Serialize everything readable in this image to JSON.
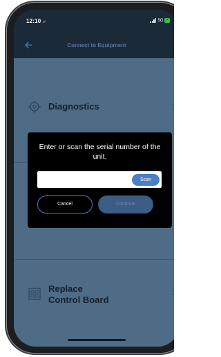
{
  "status_bar": {
    "time": "12:10",
    "network": "5G",
    "battery": "",
    "colors": {
      "battery": "#35c24a"
    }
  },
  "header": {
    "title": "Connect to Equipment",
    "back_icon": "back-arrow-icon"
  },
  "menu": {
    "items": [
      {
        "label": "Diagnostics",
        "icon": "crosshair-target-icon"
      },
      {
        "label": "Replace Control Board",
        "line1": "Replace",
        "line2": "Control Board",
        "icon": "control-board-icon"
      }
    ]
  },
  "dialog": {
    "message": "Enter or scan the serial number of the unit.",
    "input_value": "",
    "scan_label": "Scan",
    "cancel_label": "Cancel",
    "continue_label": "Continue",
    "colors": {
      "accent": "#4a7fc1",
      "disabled": "#3a5c85"
    }
  }
}
